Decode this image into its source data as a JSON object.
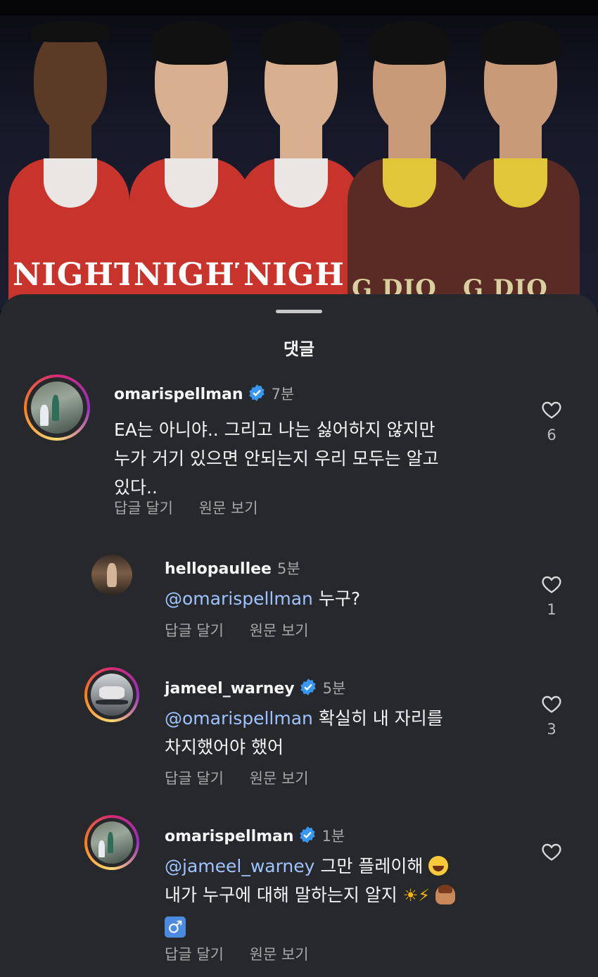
{
  "sheet": {
    "title": "댓글"
  },
  "banner": {
    "jersey_texts": [
      "NIGHT",
      "NIGHT",
      "NIGH",
      "G DIO",
      "G DIO"
    ]
  },
  "comments": [
    {
      "username": "omarispellman",
      "verified": true,
      "time": "7분",
      "text": "EA는 아니야.. 그리고 나는 싫어하지 않지만\n누가 거기 있으면 안되는지 우리 모두는 알고\n있다..",
      "reply_label": "답글 달기",
      "original_label": "원문 보기",
      "likes": "6",
      "avatar_icon": "story-ring-avatar"
    },
    {
      "username": "hellopaullee",
      "verified": false,
      "time": "5분",
      "mention": "@omarispellman",
      "text": " 누구?",
      "reply_label": "답글 달기",
      "original_label": "원문 보기",
      "likes": "1",
      "avatar_icon": "plain-avatar"
    },
    {
      "username": "jameel_warney",
      "verified": true,
      "time": "5분",
      "mention": "@omarispellman",
      "text": " 확실히 내 자리를\n차지했어야 했어",
      "reply_label": "답글 달기",
      "original_label": "원문 보기",
      "likes": "3",
      "avatar_icon": "story-ring-avatar"
    },
    {
      "username": "omarispellman",
      "verified": true,
      "time": "1분",
      "mention": "@jameel_warney",
      "text_line1": " 그만 플레이해 ",
      "text_line2": "내가 누구에 대해 말하는지 알지 ",
      "emoji": [
        "face-with-tears-of-joy",
        "sun-icon",
        "high-voltage-icon",
        "person-gesturing-no-icon",
        "male-sign-icon"
      ],
      "reply_label": "답글 달기",
      "original_label": "원문 보기",
      "likes": "",
      "avatar_icon": "story-ring-avatar"
    }
  ],
  "colors": {
    "sheet_bg": "#26282c",
    "mention": "#9ec3ff",
    "verified": "#3897f0",
    "secondary_text": "#a8a8a8"
  }
}
